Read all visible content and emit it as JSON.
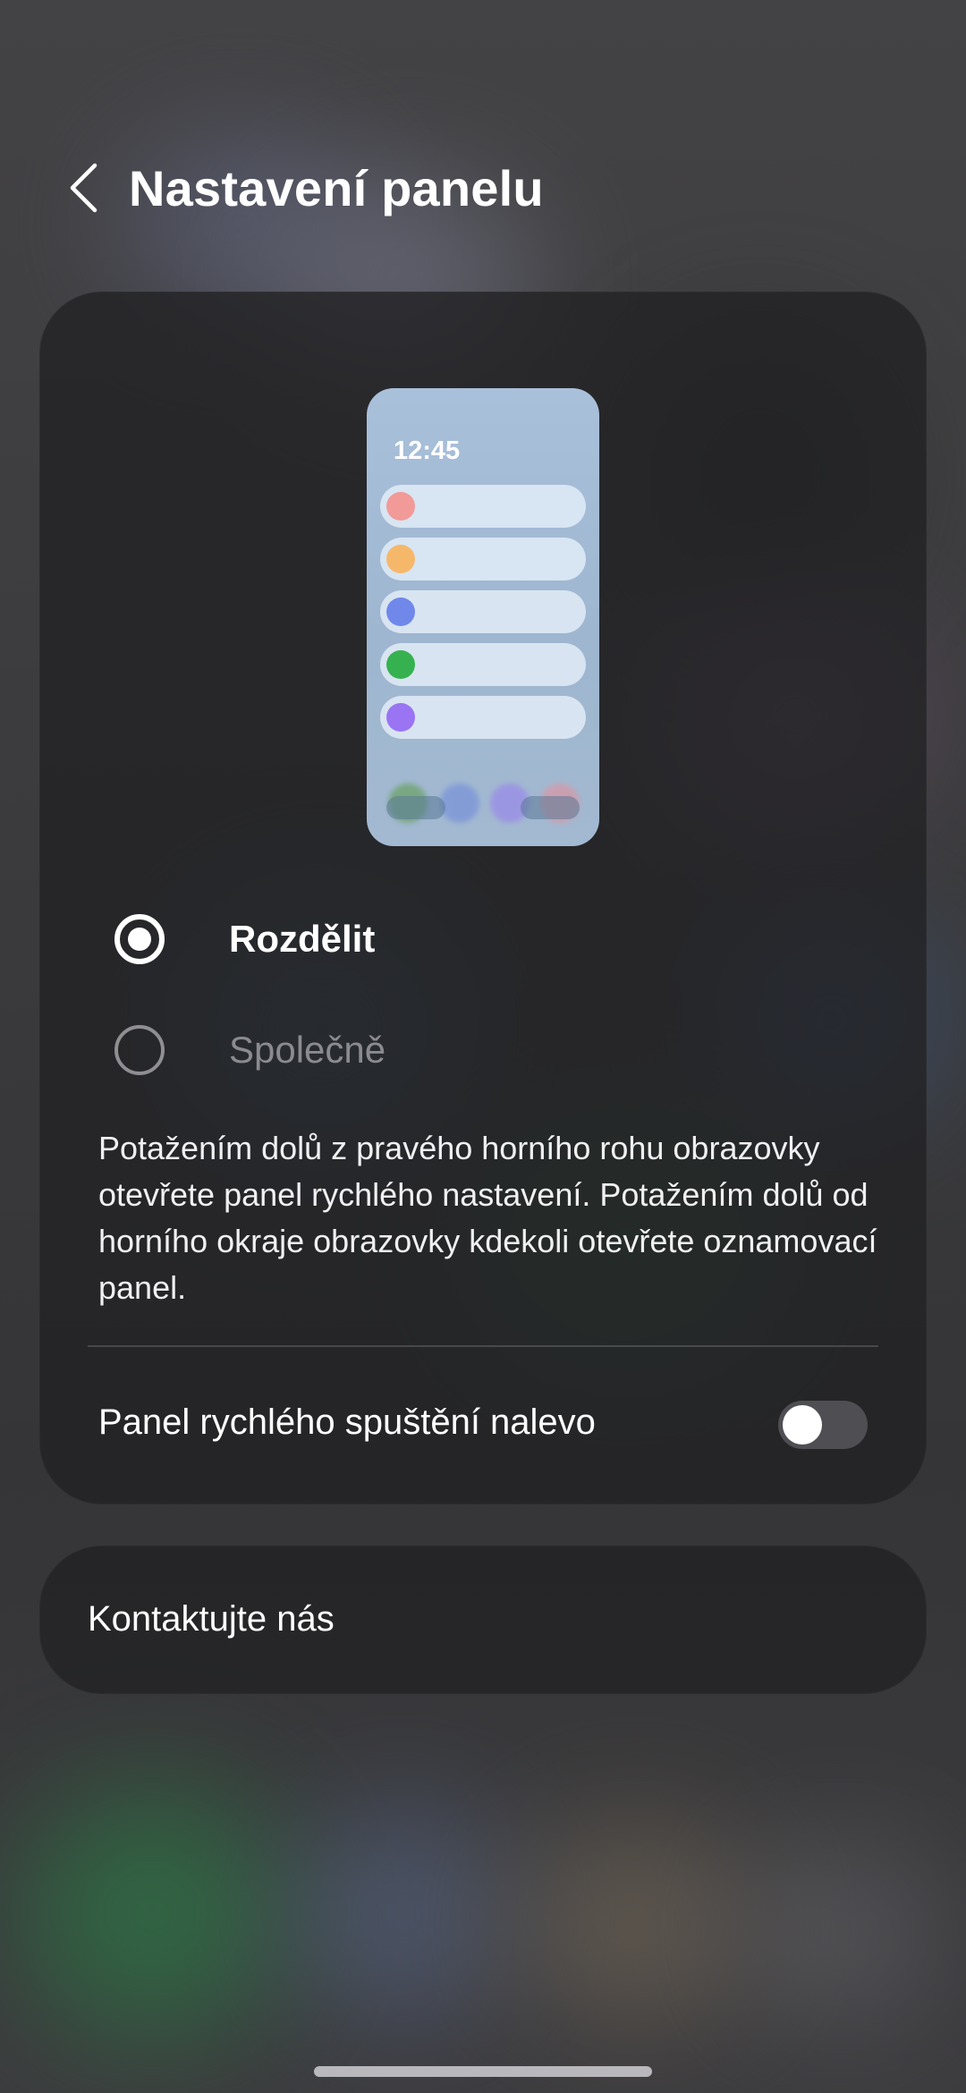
{
  "header": {
    "title": "Nastavení panelu",
    "back_icon": "chevron-left-icon"
  },
  "preview": {
    "time": "12:45",
    "row_colors": [
      "#f19a98",
      "#f5b86b",
      "#7088ea",
      "#35b24f",
      "#9a74f2"
    ]
  },
  "options": [
    {
      "label": "Rozdělit",
      "selected": true
    },
    {
      "label": "Společně",
      "selected": false
    }
  ],
  "description": "Potažením dolů z pravého horního rohu obrazovky otevřete panel rychlého nastavení. Potažením dolů od horního okraje obrazovky kdekoli otevřete oznamovací panel.",
  "toggle": {
    "label": "Panel rychlého spuštění nalevo",
    "on": false
  },
  "contact": {
    "label": "Kontaktujte nás"
  },
  "colors": {
    "card_bg": "#222224",
    "switch_off": "#4f4f53",
    "text_primary": "#ffffff",
    "text_disabled": "#8a8a8f"
  }
}
